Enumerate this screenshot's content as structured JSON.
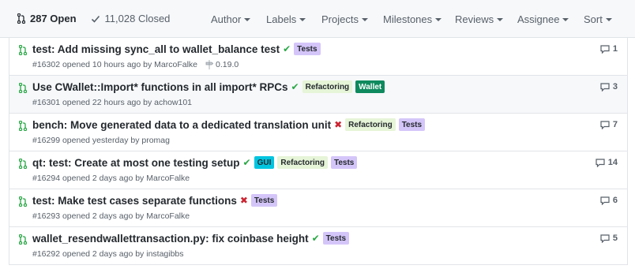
{
  "states": {
    "open_label": "287 Open",
    "closed_label": "11,028 Closed"
  },
  "filters": {
    "author": "Author",
    "labels": "Labels",
    "projects": "Projects",
    "milestones": "Milestones",
    "reviews": "Reviews",
    "assignee": "Assignee",
    "sort": "Sort"
  },
  "colors": {
    "open_icon": "#28a745",
    "check": "#28a745",
    "cross": "#cb2431",
    "label_tests": "#d4c5f9",
    "label_refactoring": "#e6f4d7",
    "label_wallet": "#0e8a5e",
    "label_gui": "#00c5e0"
  },
  "issues": [
    {
      "title": "test: Add missing sync_all to wallet_balance test",
      "status": "✔",
      "labels": [
        "Tests"
      ],
      "number": "#16302",
      "opened": "opened 10 hours ago by",
      "author": "MarcoFalke",
      "milestone": "0.19.0",
      "comments": "1"
    },
    {
      "title": "Use CWallet::Import* functions in all import* RPCs",
      "status": "✔",
      "labels": [
        "Refactoring",
        "Wallet"
      ],
      "number": "#16301",
      "opened": "opened 22 hours ago by",
      "author": "achow101",
      "comments": "3"
    },
    {
      "title": "bench: Move generated data to a dedicated translation unit",
      "status": "✖",
      "labels": [
        "Refactoring",
        "Tests"
      ],
      "number": "#16299",
      "opened": "opened yesterday by",
      "author": "promag",
      "comments": "7"
    },
    {
      "title": "qt: test: Create at most one testing setup",
      "status": "✔",
      "labels": [
        "GUI",
        "Refactoring",
        "Tests"
      ],
      "number": "#16294",
      "opened": "opened 2 days ago by",
      "author": "MarcoFalke",
      "comments": "14"
    },
    {
      "title": "test: Make test cases separate functions",
      "status": "✖",
      "labels": [
        "Tests"
      ],
      "number": "#16293",
      "opened": "opened 2 days ago by",
      "author": "MarcoFalke",
      "comments": "6"
    },
    {
      "title": "wallet_resendwallettransaction.py: fix coinbase height",
      "status": "✔",
      "labels": [
        "Tests"
      ],
      "number": "#16292",
      "opened": "opened 2 days ago by",
      "author": "instagibbs",
      "comments": "5"
    }
  ]
}
